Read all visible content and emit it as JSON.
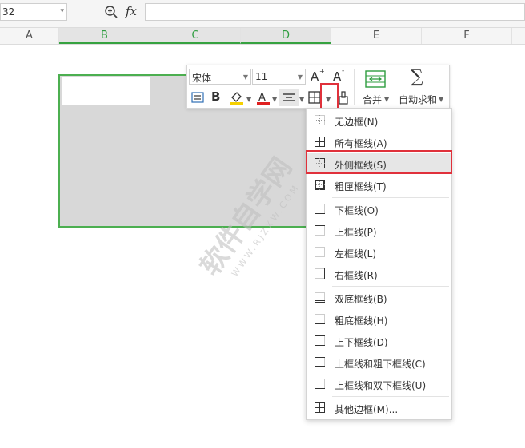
{
  "formula_bar": {
    "name_box_value": "32",
    "fx_label": "fx",
    "formula_value": ""
  },
  "columns": [
    "A",
    "B",
    "C",
    "D",
    "E",
    "F"
  ],
  "selected_columns": [
    "B",
    "C",
    "D"
  ],
  "mini_toolbar": {
    "font_name": "宋体",
    "font_size": "11",
    "increase_font_icon": "font-grow-icon",
    "decrease_font_icon": "font-shrink-icon",
    "bold_label": "B",
    "font_color_label": "A",
    "merge_label": "合并",
    "autosum_label": "自动求和"
  },
  "border_menu": {
    "items": [
      {
        "label": "无边框(N)",
        "icon": "no-border-icon"
      },
      {
        "label": "所有框线(A)",
        "icon": "all-borders-icon"
      },
      {
        "label": "外侧框线(S)",
        "icon": "outside-borders-icon",
        "highlighted": true
      },
      {
        "label": "粗匣框线(T)",
        "icon": "thick-box-border-icon"
      },
      {
        "label": "下框线(O)",
        "icon": "bottom-border-icon"
      },
      {
        "label": "上框线(P)",
        "icon": "top-border-icon"
      },
      {
        "label": "左框线(L)",
        "icon": "left-border-icon"
      },
      {
        "label": "右框线(R)",
        "icon": "right-border-icon"
      },
      {
        "label": "双底框线(B)",
        "icon": "double-bottom-border-icon"
      },
      {
        "label": "粗底框线(H)",
        "icon": "thick-bottom-border-icon"
      },
      {
        "label": "上下框线(D)",
        "icon": "top-bottom-border-icon"
      },
      {
        "label": "上框线和粗下框线(C)",
        "icon": "top-thick-bottom-border-icon"
      },
      {
        "label": "上框线和双下框线(U)",
        "icon": "top-double-bottom-border-icon"
      },
      {
        "label": "其他边框(M)...",
        "icon": "more-borders-icon"
      }
    ]
  },
  "colors": {
    "selection_border": "#4caf50",
    "highlight_red": "#e0313b",
    "font_color_bar": "#e02020",
    "fill_color_bar": "#f5d000"
  },
  "watermark": {
    "text": "软件自学网",
    "url": "WWW.RJZXW.COM"
  }
}
